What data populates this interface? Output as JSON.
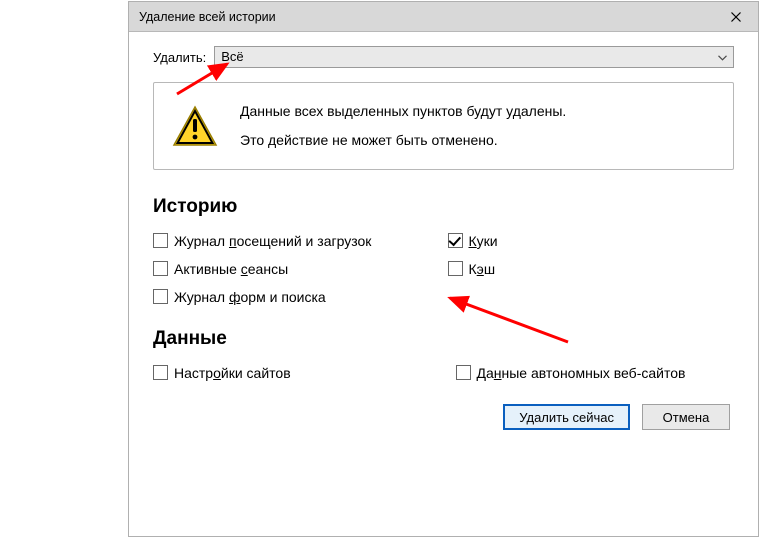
{
  "titlebar": {
    "title": "Удаление всей истории"
  },
  "delete_row": {
    "label": "Удалить:",
    "select_value": "Всё"
  },
  "warning": {
    "line1": "Данные всех выделенных пунктов будут удалены.",
    "line2": "Это действие не может быть отменено."
  },
  "sections": {
    "history": "Историю",
    "data": "Данные"
  },
  "history_checks": {
    "browsing": {
      "label_pre": "Журнал ",
      "u": "п",
      "label_post": "осещений и загрузок",
      "checked": false
    },
    "cookies": {
      "label_pre": "",
      "u": "К",
      "label_post": "уки",
      "checked": true
    },
    "sessions": {
      "label_pre": "Активные ",
      "u": "с",
      "label_post": "еансы",
      "checked": false
    },
    "cache": {
      "label_pre": "К",
      "u": "э",
      "label_post": "ш",
      "checked": false
    },
    "forms": {
      "label_pre": "Журнал ",
      "u": "ф",
      "label_post": "орм и поиска",
      "checked": false
    }
  },
  "data_checks": {
    "site_settings": {
      "label_pre": "Настр",
      "u": "о",
      "label_post": "йки сайтов",
      "checked": false
    },
    "offline": {
      "label_pre": "Да",
      "u": "н",
      "label_post": "ные автономных веб-сайтов",
      "checked": false
    }
  },
  "buttons": {
    "delete_now": "Удалить сейчас",
    "cancel": "Отмена"
  }
}
